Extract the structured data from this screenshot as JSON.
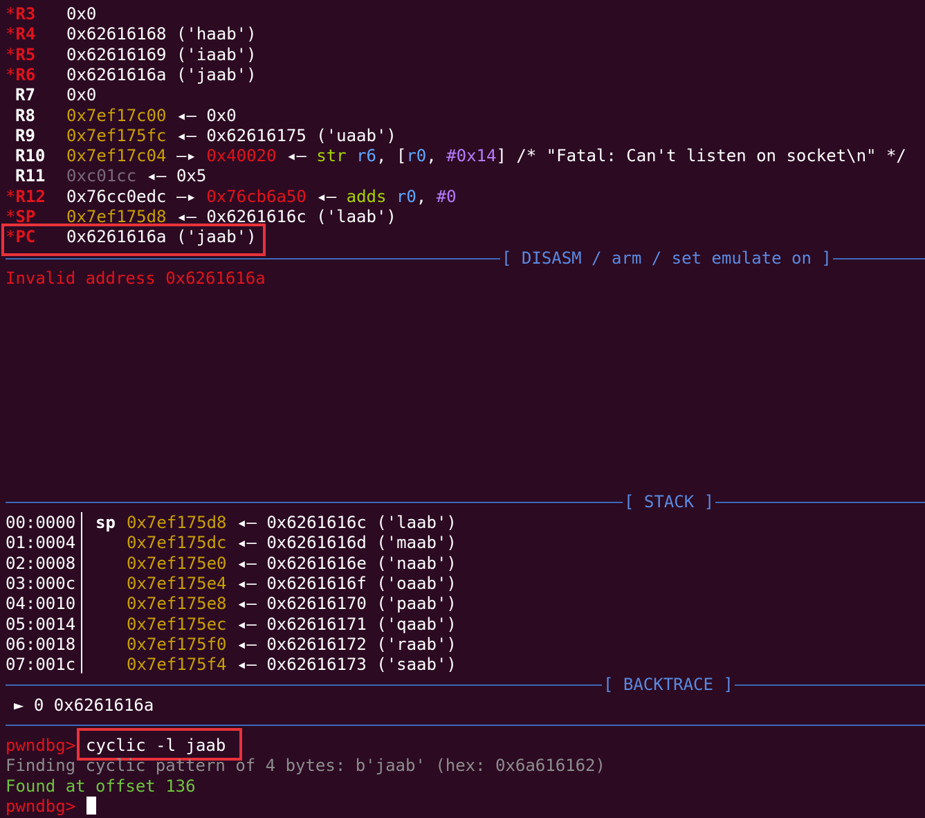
{
  "registers": [
    {
      "mark": "*",
      "name": "R3",
      "value": "0x0"
    },
    {
      "mark": "*",
      "name": "R4",
      "value": "0x62616168 ('haab')"
    },
    {
      "mark": "*",
      "name": "R5",
      "value": "0x62616169 ('iaab')"
    },
    {
      "mark": "*",
      "name": "R6",
      "value": "0x6261616a ('jaab')"
    },
    {
      "mark": "",
      "name": "R7",
      "value": "0x0"
    },
    {
      "mark": "",
      "name": "R8",
      "addr": "0x7ef17c00",
      "rest": "0x0"
    },
    {
      "mark": "",
      "name": "R9",
      "addr": "0x7ef175fc",
      "rest": "0x62616175 ('uaab')"
    },
    {
      "mark": "",
      "name": "R10",
      "addr": "0x7ef17c04",
      "addr2": "0x40020",
      "instr": "str",
      "op1": "r6",
      "op2": "r0",
      "op3": "#0x14",
      "comment": "/* \"Fatal: Can't listen on socket\\n\" */"
    },
    {
      "mark": "",
      "name": "R11",
      "addr": "0xc01cc",
      "rest": "0x5"
    },
    {
      "mark": "*",
      "name": "R12",
      "addr": "0x76cc0edc",
      "addr2": "0x76cb6a50",
      "instr": "adds",
      "op1": "r0",
      "op2": "#0"
    },
    {
      "mark": "*",
      "name": "SP",
      "addr": "0x7ef175d8",
      "rest": "0x6261616c ('laab')"
    },
    {
      "mark": "*",
      "name": "PC",
      "value": "0x6261616a ('jaab')"
    }
  ],
  "arrows": {
    "left": "◂—",
    "right": "—▸"
  },
  "sections": {
    "disasm": "[ DISASM / arm / set emulate on ]",
    "stack": "[ STACK ]",
    "backtrace": "[ BACKTRACE ]"
  },
  "disasm": {
    "message": "Invalid address 0x6261616a"
  },
  "stack": [
    {
      "offset": "00:0000",
      "label": "sp",
      "addr": "0x7ef175d8",
      "value": "0x6261616c ('laab')"
    },
    {
      "offset": "01:0004",
      "label": "",
      "addr": "0x7ef175dc",
      "value": "0x6261616d ('maab')"
    },
    {
      "offset": "02:0008",
      "label": "",
      "addr": "0x7ef175e0",
      "value": "0x6261616e ('naab')"
    },
    {
      "offset": "03:000c",
      "label": "",
      "addr": "0x7ef175e4",
      "value": "0x6261616f ('oaab')"
    },
    {
      "offset": "04:0010",
      "label": "",
      "addr": "0x7ef175e8",
      "value": "0x62616170 ('paab')"
    },
    {
      "offset": "05:0014",
      "label": "",
      "addr": "0x7ef175ec",
      "value": "0x62616171 ('qaab')"
    },
    {
      "offset": "06:0018",
      "label": "",
      "addr": "0x7ef175f0",
      "value": "0x62616172 ('raab')"
    },
    {
      "offset": "07:001c",
      "label": "",
      "addr": "0x7ef175f4",
      "value": "0x62616173 ('saab')"
    }
  ],
  "backtrace": {
    "marker": "►",
    "frame": "0 0x6261616a"
  },
  "console": {
    "prompt": "pwndbg>",
    "command": "cyclic -l jaab",
    "finding": "Finding cyclic pattern of 4 bytes: b'jaab' (hex: 0x6a616162)",
    "found": "Found at offset 136",
    "prompt2": "pwndbg>"
  },
  "colors": {
    "background": "#2c0a22",
    "changed_register": "#e0131c",
    "address": "#c8a000",
    "separator": "#3d6ab8",
    "highlight_box": "#e8323a",
    "found_text": "#6ec43e"
  }
}
